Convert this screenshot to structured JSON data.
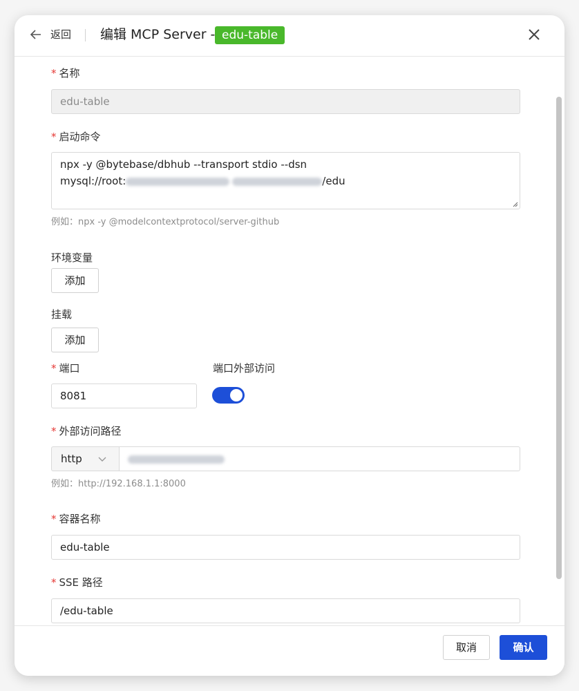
{
  "header": {
    "back_label": "返回",
    "title": "编辑 MCP Server - ",
    "tag": "edu-table"
  },
  "form": {
    "name": {
      "label": "名称",
      "value": "edu-table"
    },
    "command": {
      "label": "启动命令",
      "line1": "npx -y @bytebase/dbhub --transport stdio --dsn",
      "line2_prefix": "mysql://root:",
      "line2_suffix": "/edu",
      "hint": "例如：npx -y @modelcontextprotocol/server-github"
    },
    "env": {
      "label": "环境变量",
      "add_label": "添加"
    },
    "mount": {
      "label": "挂载",
      "add_label": "添加"
    },
    "port": {
      "label": "端口",
      "value": "8081"
    },
    "external_access": {
      "label": "端口外部访问",
      "enabled": true
    },
    "external_path": {
      "label": "外部访问路径",
      "protocol": "http",
      "hint": "例如：http://192.168.1.1:8000"
    },
    "container_name": {
      "label": "容器名称",
      "value": "edu-table"
    },
    "sse_path": {
      "label": "SSE 路径",
      "value": "/edu-table"
    }
  },
  "footer": {
    "cancel_label": "取消",
    "confirm_label": "确认"
  },
  "colors": {
    "primary": "#1d4fd8",
    "tag_green": "#49b82b",
    "required": "#e53935"
  }
}
